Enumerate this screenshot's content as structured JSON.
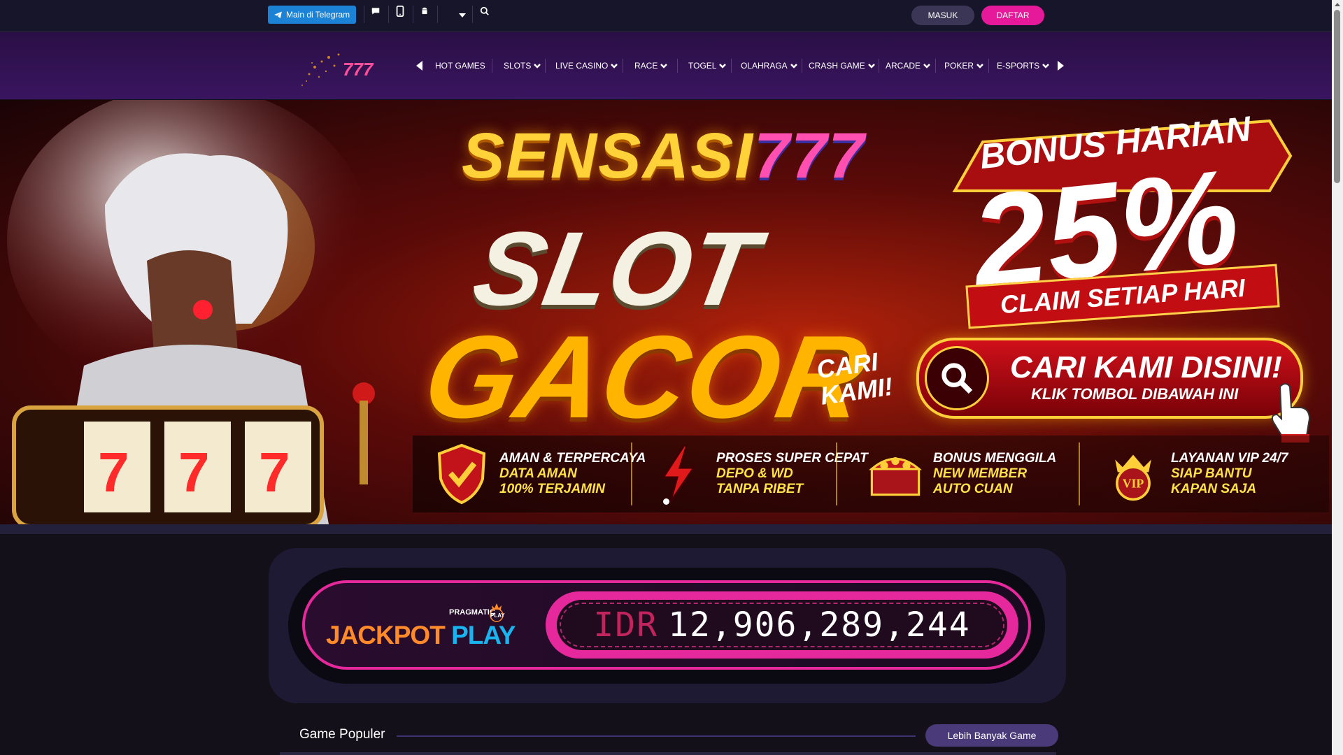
{
  "topbar": {
    "telegram_label": "Main di Telegram",
    "masuk_label": "MASUK",
    "daftar_label": "DAFTAR",
    "accent_pink": "#e6199a",
    "telegram_blue": "#1b82d6"
  },
  "nav": {
    "items": [
      {
        "label": "HOT GAMES",
        "has_dropdown": false
      },
      {
        "label": "SLOTS",
        "has_dropdown": true
      },
      {
        "label": "LIVE CASINO",
        "has_dropdown": true
      },
      {
        "label": "RACE",
        "has_dropdown": true
      },
      {
        "label": "TOGEL",
        "has_dropdown": true
      },
      {
        "label": "OLAHRAGA",
        "has_dropdown": true
      },
      {
        "label": "CRASH GAME",
        "has_dropdown": true
      },
      {
        "label": "ARCADE",
        "has_dropdown": true
      },
      {
        "label": "POKER",
        "has_dropdown": true
      },
      {
        "label": "E-SPORTS",
        "has_dropdown": true
      }
    ]
  },
  "banner": {
    "title_word": "SENSASI",
    "title_num": "777",
    "slot": "SLOT",
    "gacor": "GACOR",
    "cari_kami_1": "CARI",
    "cari_kami_2": "KAMI!",
    "bonus_title": "BONUS HARIAN",
    "bonus_pct": "25%",
    "claim": "CLAIM SETIAP HARI",
    "cta_main": "CARI KAMI DISINI!",
    "cta_sub": "KLIK TOMBOL DIBAWAH INI",
    "features": [
      {
        "l1": "AMAN & TERPERCAYA",
        "l2": "DATA AMAN",
        "l3": "100% TERJAMIN",
        "icon": "shield-check-icon"
      },
      {
        "l1": "PROSES SUPER CEPAT",
        "l2": "DEPO & WD",
        "l3": "TANPA RIBET",
        "icon": "lightning-icon"
      },
      {
        "l1": "BONUS MENGGILA",
        "l2": "NEW MEMBER",
        "l3": "AUTO CUAN",
        "icon": "treasure-chest-icon"
      },
      {
        "l1": "LAYANAN VIP 24/7",
        "l2": "SIAP BANTU",
        "l3": "KAPAN SAJA",
        "icon": "vip-crown-icon"
      }
    ]
  },
  "jackpot": {
    "brand": "PRAGMATIC",
    "brand_badge": "PLAY",
    "label_jackpot": "JACKPOT",
    "label_play": "PLAY",
    "currency": "IDR",
    "amount": "12,906,289,244",
    "accent": "#e5289b"
  },
  "games": {
    "title": "Game Populer",
    "more_label": "Lebih Banyak Game"
  }
}
